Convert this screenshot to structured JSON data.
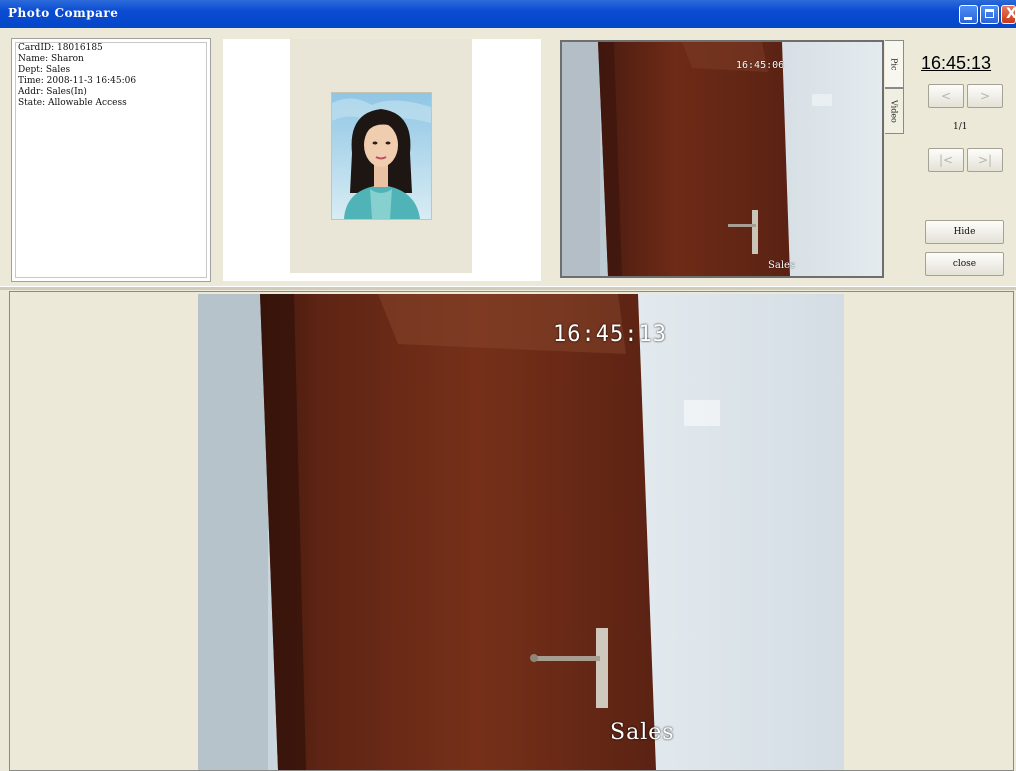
{
  "window": {
    "title": "Photo Compare",
    "controls": {
      "minimize_icon": "minimize-icon",
      "maximize_icon": "maximize-icon",
      "close_icon": "close-icon",
      "close_glyph": "X"
    }
  },
  "record_info": {
    "lines": [
      "CardID: 18016185",
      "Name: Sharon",
      "Dept: Sales",
      "Time: 2008-11-3 16:45:06",
      "Addr: Sales(In)",
      "State: Allowable Access"
    ]
  },
  "snapshot": {
    "timestamp": "16:45:06",
    "location": "Sales"
  },
  "tabs": [
    {
      "label": "Pic",
      "selected": true
    },
    {
      "label": "Video",
      "selected": false
    }
  ],
  "controls": {
    "clock": "16:45:13",
    "prev_label": "<",
    "next_label": ">",
    "page_indicator": "1/1",
    "first_label": "|<",
    "last_label": ">|",
    "hide_label": "Hide",
    "close_label": "close"
  },
  "live_view": {
    "timestamp": "16:45:13",
    "location": "Sales"
  },
  "colors": {
    "titlebar": "#0a4bd3",
    "window_bg": "#ece9d8",
    "door": "#6b2a1a",
    "wall": "#dce4ea"
  }
}
